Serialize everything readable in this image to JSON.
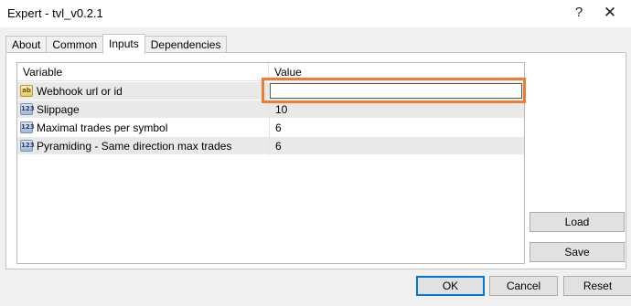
{
  "window": {
    "title": "Expert - tvl_v0.2.1",
    "help_glyph": "?",
    "close_glyph": "✕"
  },
  "tabs": [
    {
      "label": "About",
      "active": false
    },
    {
      "label": "Common",
      "active": false
    },
    {
      "label": "Inputs",
      "active": true
    },
    {
      "label": "Dependencies",
      "active": false
    }
  ],
  "grid": {
    "columns": {
      "variable": "Variable",
      "value": "Value"
    },
    "rows": [
      {
        "type_icon": "string-type-icon",
        "icon_text": "ab",
        "name": "Webhook url or id",
        "value": ""
      },
      {
        "type_icon": "number-type-icon",
        "icon_text": "123",
        "name": "Slippage",
        "value": "10"
      },
      {
        "type_icon": "number-type-icon",
        "icon_text": "123",
        "name": "Maximal trades per symbol",
        "value": "6"
      },
      {
        "type_icon": "number-type-icon",
        "icon_text": "123",
        "name": "Pyramiding - Same direction max trades",
        "value": "6"
      }
    ]
  },
  "side_buttons": {
    "load": "Load",
    "save": "Save"
  },
  "bottom_buttons": {
    "ok": "OK",
    "cancel": "Cancel",
    "reset": "Reset"
  },
  "colors": {
    "highlight": "#ed7d31",
    "default_button_border": "#0078d7",
    "alt_row": "#e9e9e9"
  }
}
